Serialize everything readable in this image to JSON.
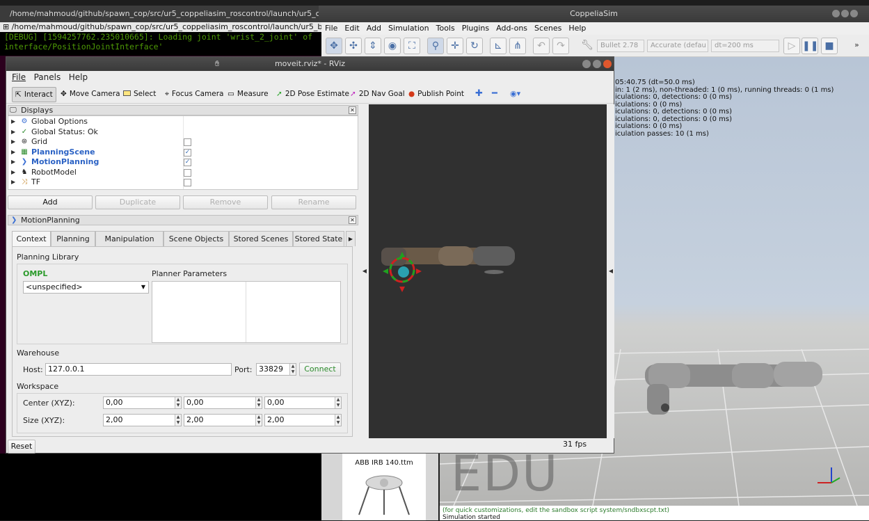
{
  "terminal": {
    "title": "/home/mahmoud/github/spawn_cop/src/ur5_coppeliasim_roscontrol/launch/ur5_c",
    "tab_title": "/home/mahmoud/github/spawn_cop/src/ur5_coppeliasim_roscontrol/launch/ur5_b",
    "lines": [
      "[DEBUG] [1594257762.235010665]: Loading joint 'wrist_2_joint' of",
      "interface/PositionJointInterface'"
    ]
  },
  "coppelia": {
    "title": "CoppeliaSim",
    "menu": [
      "File",
      "Edit",
      "Add",
      "Simulation",
      "Tools",
      "Plugins",
      "Add-ons",
      "Scenes",
      "Help"
    ],
    "engine": "Bullet 2.78",
    "accuracy": "Accurate (defau",
    "dt": "dt=200 ms",
    "info_lines": "05:40.75 (dt=50.0 ms)\nin: 1 (2 ms), non-threaded: 1 (0 ms), running threads: 0 (1 ms)\niculations: 0, detections: 0 (0 ms)\niculations: 0 (0 ms)\niculations: 0, detections: 0 (0 ms)\niculations: 0, detections: 0 (0 ms)\niculations: 0 (0 ms)\niculation passes: 10 (1 ms)",
    "model_label": "ABB IRB 140.ttm",
    "watermark": "EDU",
    "status_line1": "(for quick customizations, edit the sandbox script system/sndbxscpt.txt)",
    "status_line2": "Simulation started"
  },
  "rviz": {
    "title": "moveit.rviz* - RViz",
    "menu": [
      "File",
      "Panels",
      "Help"
    ],
    "tools": [
      "Interact",
      "Move Camera",
      "Select",
      "Focus Camera",
      "Measure",
      "2D Pose Estimate",
      "2D Nav Goal",
      "Publish Point"
    ],
    "displays_header": "Displays",
    "displays": [
      {
        "label": "Global Options",
        "icon": "gear",
        "checked": null,
        "highlight": false
      },
      {
        "label": "Global Status: Ok",
        "icon": "check",
        "checked": null,
        "highlight": false
      },
      {
        "label": "Grid",
        "icon": "grid",
        "checked": false,
        "highlight": false
      },
      {
        "label": "PlanningScene",
        "icon": "scene",
        "checked": true,
        "highlight": true
      },
      {
        "label": "MotionPlanning",
        "icon": "motion",
        "checked": true,
        "highlight": true
      },
      {
        "label": "RobotModel",
        "icon": "robot",
        "checked": false,
        "highlight": false
      },
      {
        "label": "TF",
        "icon": "tf",
        "checked": false,
        "highlight": false
      }
    ],
    "display_buttons": {
      "add": "Add",
      "duplicate": "Duplicate",
      "remove": "Remove",
      "rename": "Rename"
    },
    "mp_header": "MotionPlanning",
    "tabs": [
      "Context",
      "Planning",
      "Manipulation",
      "Scene Objects",
      "Stored Scenes",
      "Stored State"
    ],
    "planning_library": "Planning Library",
    "ompl": "OMPL",
    "planner": "<unspecified>",
    "planner_params": "Planner Parameters",
    "warehouse": "Warehouse",
    "host_label": "Host:",
    "host": "127.0.0.1",
    "port_label": "Port:",
    "port": "33829",
    "connect": "Connect",
    "workspace": "Workspace",
    "center_label": "Center (XYZ):",
    "center": [
      "0,00",
      "0,00",
      "0,00"
    ],
    "size_label": "Size (XYZ):",
    "size": [
      "2,00",
      "2,00",
      "2,00"
    ],
    "reset": "Reset",
    "fps": "31 fps"
  }
}
